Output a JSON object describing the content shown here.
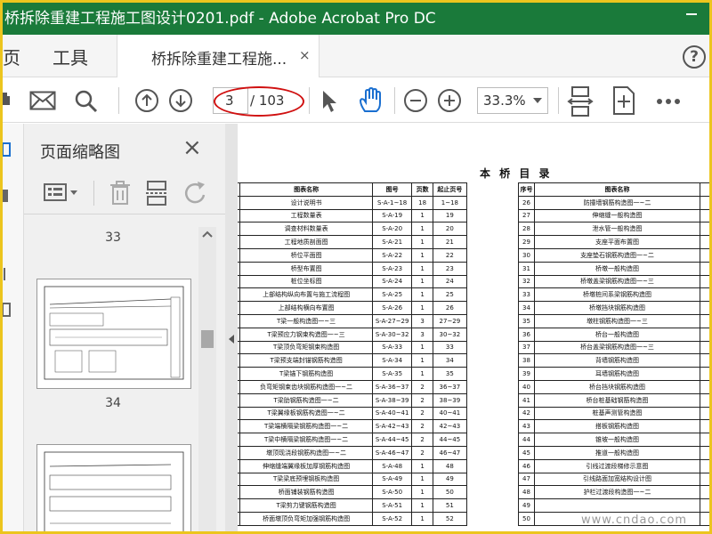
{
  "titlebar": {
    "title": "桥拆除重建工程施工图设计0201.pdf - Adobe Acrobat Pro DC"
  },
  "menubar": {
    "home": "页",
    "tools": "工具",
    "doc_tab": "桥拆除重建工程施...",
    "close_glyph": "×",
    "help_glyph": "?"
  },
  "toolbar": {
    "current_page": "3",
    "page_total": "/ 103",
    "zoom": "33.3%"
  },
  "thumbnails": {
    "title": "页面缩略图",
    "close_glyph": "×",
    "page_labels": [
      "33",
      "34"
    ]
  },
  "document": {
    "heading": "本 桥 目 录",
    "headers": [
      "序号",
      "图表名称",
      "图号",
      "页数",
      "起止页号"
    ],
    "left_rows": [
      [
        "1",
        "设计说明书",
        "S-A-1~18",
        "18",
        "1~18"
      ],
      [
        "2",
        "工程数量表",
        "S-A-19",
        "1",
        "19"
      ],
      [
        "3",
        "调查材料数量表",
        "S-A-20",
        "1",
        "20"
      ],
      [
        "4",
        "工程地质剖面图",
        "S-A-21",
        "1",
        "21"
      ],
      [
        "5",
        "桥位平面图",
        "S-A-22",
        "1",
        "22"
      ],
      [
        "6",
        "桥型布置图",
        "S-A-23",
        "1",
        "23"
      ],
      [
        "7",
        "桩位坐标图",
        "S-A-24",
        "1",
        "24"
      ],
      [
        "8",
        "上部结构纵向布置与施工流程图",
        "S-A-25",
        "1",
        "25"
      ],
      [
        "9",
        "上部结构横向布置图",
        "S-A-26",
        "1",
        "26"
      ],
      [
        "10",
        "T梁一般构造图一~三",
        "S-A-27~29",
        "3",
        "27~29"
      ],
      [
        "11",
        "T梁预应力钢束构造图一~三",
        "S-A-30~32",
        "3",
        "30~32"
      ],
      [
        "12",
        "T梁顶负弯矩钢束构造图",
        "S-A-33",
        "1",
        "33"
      ],
      [
        "13",
        "T梁预支端封锚钢筋构造图",
        "S-A-34",
        "1",
        "34"
      ],
      [
        "14",
        "T梁锚下钢筋构造图",
        "S-A-35",
        "1",
        "35"
      ],
      [
        "15",
        "负弯矩钢束齿块钢筋构造图一~二",
        "S-A-36~37",
        "2",
        "36~37"
      ],
      [
        "16",
        "T梁肋钢筋构造图一~二",
        "S-A-38~39",
        "2",
        "38~39"
      ],
      [
        "17",
        "T梁翼缘板钢筋构造图一~二",
        "S-A-40~41",
        "2",
        "40~41"
      ],
      [
        "18",
        "T梁端横隔梁钢筋构造图一~二",
        "S-A-42~43",
        "2",
        "42~43"
      ],
      [
        "19",
        "T梁中横隔梁钢筋构造图一~二",
        "S-A-44~45",
        "2",
        "44~45"
      ],
      [
        "20",
        "墩顶现浇段钢筋构造图一~二",
        "S-A-46~47",
        "2",
        "46~47"
      ],
      [
        "21",
        "伸缩缝端翼缘板加厚钢筋构造图",
        "S-A-48",
        "1",
        "48"
      ],
      [
        "22",
        "T梁梁底预埋钢板构造图",
        "S-A-49",
        "1",
        "49"
      ],
      [
        "23",
        "桥面铺装钢筋构造图",
        "S-A-50",
        "1",
        "50"
      ],
      [
        "24",
        "T梁剪力键钢筋构造图",
        "S-A-51",
        "1",
        "51"
      ],
      [
        "25",
        "桥面墩顶负弯矩加强钢筋构造图",
        "S-A-52",
        "1",
        "52"
      ]
    ],
    "right_rows": [
      [
        "26",
        "防撞墙钢筋构造图一~二",
        "S-A"
      ],
      [
        "27",
        "伸缩缝一般构造图",
        "S-A"
      ],
      [
        "28",
        "泄水管一般构造图",
        "S-A"
      ],
      [
        "29",
        "支座平面布置图",
        "S-A"
      ],
      [
        "30",
        "支座垫石钢筋构造图一~二",
        "S-A"
      ],
      [
        "31",
        "桥墩一般构造图",
        "S-A"
      ],
      [
        "32",
        "桥墩盖梁钢筋构造图一~三",
        "S-A"
      ],
      [
        "33",
        "桥墩桩间系梁钢筋构造图",
        "S-A"
      ],
      [
        "34",
        "桥墩挡块钢筋构造图",
        "S-A"
      ],
      [
        "35",
        "墩柱钢筋构造图一~三",
        "S-A"
      ],
      [
        "36",
        "桥台一般构造图",
        "S-A"
      ],
      [
        "37",
        "桥台盖梁钢筋构造图一~三",
        "S-A"
      ],
      [
        "38",
        "背墙钢筋构造图",
        "S-A"
      ],
      [
        "39",
        "耳墙钢筋构造图",
        "S-A"
      ],
      [
        "40",
        "桥台挡块钢筋构造图",
        "S-A"
      ],
      [
        "41",
        "桥台桩基础钢筋构造图",
        "S-A"
      ],
      [
        "42",
        "桩基声测管构造图",
        "S-A"
      ],
      [
        "43",
        "搭板钢筋构造图",
        "S-A"
      ],
      [
        "44",
        "锥坡一般构造图",
        "S-A"
      ],
      [
        "45",
        "推道一般构造图",
        "S-A"
      ],
      [
        "46",
        "引线过渡段梯修示意图",
        "S-A"
      ],
      [
        "47",
        "引线路面加宽结构设计图",
        "S-A"
      ],
      [
        "48",
        "护栏过渡段构造图一~二",
        "S-A"
      ],
      [
        "49",
        "",
        ""
      ],
      [
        "50",
        "",
        ""
      ]
    ],
    "watermark": "www.cndao.com"
  },
  "colors": {
    "titlebar": "#1a7a3a",
    "border": "#ecc51e",
    "annotation": "#d01010",
    "hand_tool": "#1a6fd0"
  }
}
